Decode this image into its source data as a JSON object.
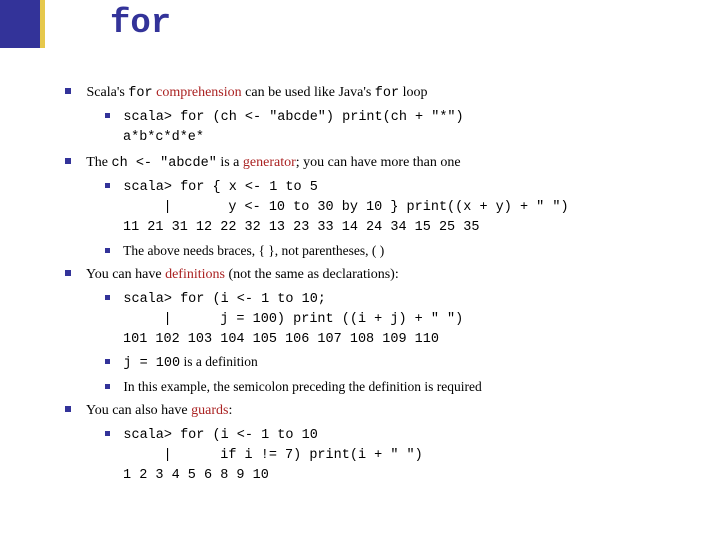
{
  "title": "for",
  "b1": {
    "pre": "Scala's ",
    "for": "for",
    "mid1": " ",
    "comp": "comprehension",
    "mid2": " can be used like Java's ",
    "for2": "for",
    "tail": " loop"
  },
  "c1": "scala> for (ch <- \"abcde\") print(ch + \"*\")\na*b*c*d*e*",
  "b2": {
    "pre": "The ",
    "code": "ch <- \"abcde\"",
    "mid": " is a ",
    "gen": "generator",
    "tail": "; you can have more than one"
  },
  "c2": "scala> for { x <- 1 to 5\n     |       y <- 10 to 30 by 10 } print((x + y) + \" \")\n11 21 31 12 22 32 13 23 33 14 24 34 15 25 35",
  "b2b": "The above needs braces, { }, not parentheses, ( )",
  "b3": {
    "pre": "You can have ",
    "defs": "definitions",
    "tail": " (not the same as declarations):"
  },
  "c3": "scala> for (i <- 1 to 10;\n     |      j = 100) print ((i + j) + \" \")\n101 102 103 104 105 106 107 108 109 110",
  "b3b": {
    "code": "j = 100",
    "tail": " is a definition"
  },
  "b3c": "In this example, the semicolon preceding the definition is required",
  "b4": {
    "pre": "You can also have ",
    "guards": "guards",
    "tail": ":"
  },
  "c4": "scala> for (i <- 1 to 10\n     |      if i != 7) print(i + \" \")\n1 2 3 4 5 6 8 9 10"
}
